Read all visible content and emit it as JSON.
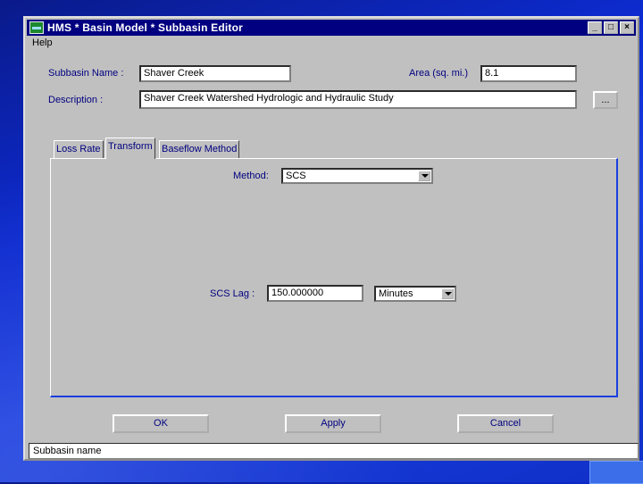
{
  "window": {
    "title": "HMS * Basin Model * Subbasin Editor",
    "minimize_glyph": "_",
    "maximize_glyph": "□",
    "close_glyph": "×"
  },
  "menu": {
    "help": "Help"
  },
  "form": {
    "subbasin_name_label": "Subbasin Name :",
    "subbasin_name_value": "Shaver Creek",
    "area_label": "Area (sq. mi.)",
    "area_value": "8.1",
    "description_label": "Description :",
    "description_value": "Shaver Creek Watershed Hydrologic and Hydraulic Study",
    "browse_label": "..."
  },
  "tabs": [
    {
      "label": "Loss Rate",
      "active": false
    },
    {
      "label": "Transform",
      "active": true
    },
    {
      "label": "Baseflow Method",
      "active": false
    }
  ],
  "transform": {
    "method_label": "Method:",
    "method_value": "SCS",
    "scs_lag_label": "SCS Lag :",
    "scs_lag_value": "150.000000",
    "units_value": "Minutes"
  },
  "buttons": {
    "ok": "OK",
    "apply": "Apply",
    "cancel": "Cancel"
  },
  "status": {
    "text": "Subbasin name"
  },
  "colors": {
    "title_bar": "#000080",
    "label_text": "#000080",
    "desktop": "#0d2bd0"
  },
  "icons": [
    "hms-app-icon",
    "minimize-icon",
    "maximize-icon",
    "close-icon",
    "dropdown-arrow-icon"
  ]
}
